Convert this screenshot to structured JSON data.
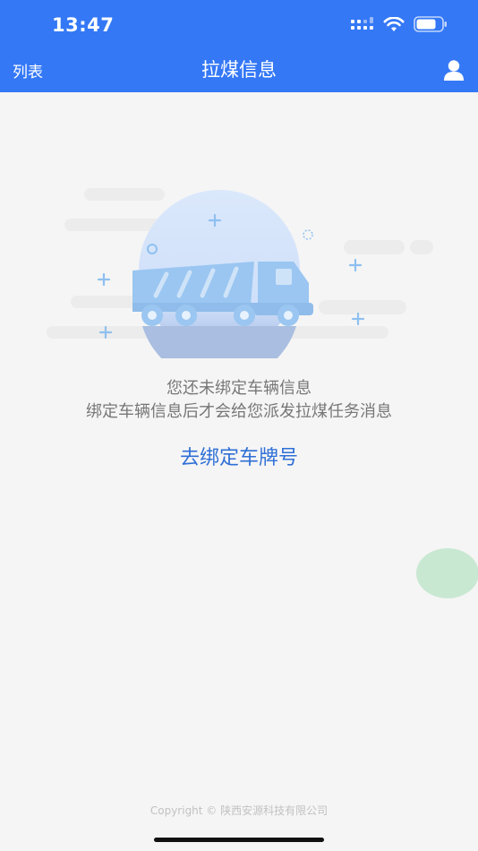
{
  "status_bar": {
    "time": "13:47"
  },
  "nav": {
    "left_label": "列表",
    "title": "拉煤信息",
    "right_icon": "user-icon"
  },
  "empty_state": {
    "line1": "您还未绑定车辆信息",
    "line2": "绑定车辆信息后才会给您派发拉煤任务消息",
    "action": "去绑定车牌号"
  },
  "footer": {
    "copyright": "Copyright © 陕西安源科技有限公司"
  },
  "colors": {
    "header": "#3478f6",
    "link": "#2f6fd6",
    "background": "#f5f5f5"
  }
}
